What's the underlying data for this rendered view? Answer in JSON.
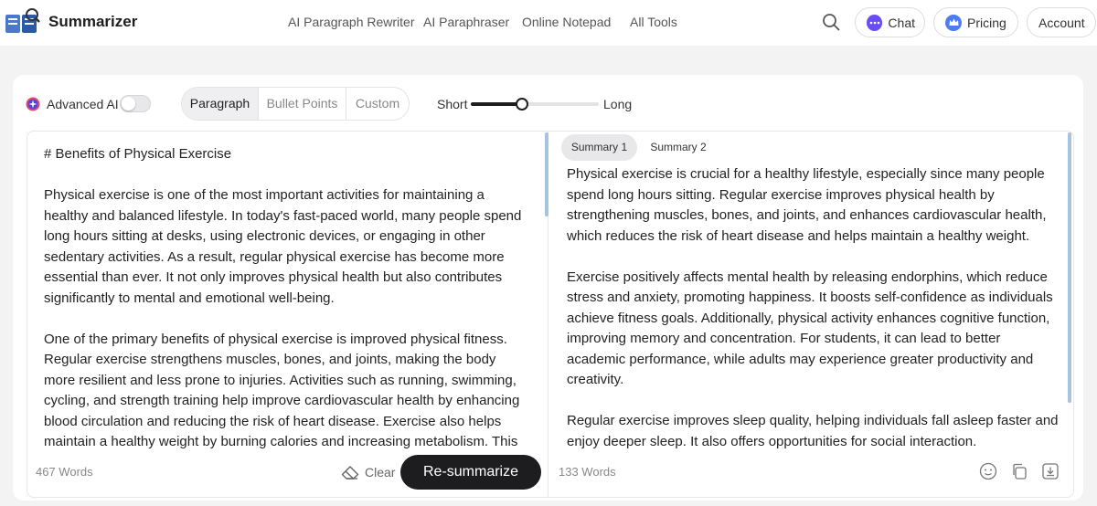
{
  "header": {
    "app_name": "Summarizer",
    "nav": [
      "AI Paragraph Rewriter",
      "AI Paraphraser",
      "Online Notepad",
      "All Tools"
    ],
    "chat_label": "Chat",
    "pricing_label": "Pricing",
    "account_label": "Account"
  },
  "toolbar": {
    "advanced_ai_label": "Advanced AI",
    "advanced_ai_on": false,
    "modes": [
      "Paragraph",
      "Bullet Points",
      "Custom"
    ],
    "active_mode": "Paragraph",
    "length_short": "Short",
    "length_long": "Long",
    "length_level": 0.4
  },
  "input": {
    "heading": "# Benefits of Physical Exercise",
    "paragraphs": [
      "Physical exercise is one of the most important activities for maintaining a healthy and balanced lifestyle. In today's fast-paced world, many people spend long hours sitting at desks, using electronic devices, or engaging in other sedentary activities. As a result, regular physical exercise has become more essential than ever. It not only improves physical health but also contributes significantly to mental and emotional well-being.",
      "One of the primary benefits of physical exercise is improved physical fitness. Regular exercise strengthens muscles, bones, and joints, making the body more resilient and less prone to injuries. Activities such as running, swimming, cycling, and strength training help improve cardiovascular health by enhancing blood circulation and reducing the risk of heart disease. Exercise also helps maintain a healthy weight by burning calories and increasing metabolism. This"
    ],
    "word_count": "467 Words",
    "clear_label": "Clear",
    "resummarize_label": "Re-summarize"
  },
  "output": {
    "tabs": [
      "Summary 1",
      "Summary 2"
    ],
    "active_tab": "Summary 1",
    "paragraphs": [
      "Physical exercise is crucial for a healthy lifestyle, especially since many people spend long hours sitting. Regular exercise improves physical health by strengthening muscles, bones, and joints, and enhances cardiovascular health, which reduces the risk of heart disease and helps maintain a healthy weight.",
      "Exercise positively affects mental health by releasing endorphins, which reduce stress and anxiety, promoting happiness. It boosts self-confidence as individuals achieve fitness goals. Additionally, physical activity enhances cognitive function, improving memory and concentration. For students, it can lead to better academic performance, while adults may experience greater productivity and creativity.",
      "Regular exercise improves sleep quality, helping individuals fall asleep faster and enjoy deeper sleep. It also offers opportunities for social interaction."
    ],
    "word_count": "133 Words",
    "icons": [
      "feedback-icon",
      "copy-icon",
      "download-icon"
    ]
  },
  "colors": {
    "accent_dark": "#1d1d1f",
    "scrollbar": "#a7c3e0",
    "chat_icon": "#6a4cf5",
    "pricing_icon": "#4d7cf0"
  }
}
